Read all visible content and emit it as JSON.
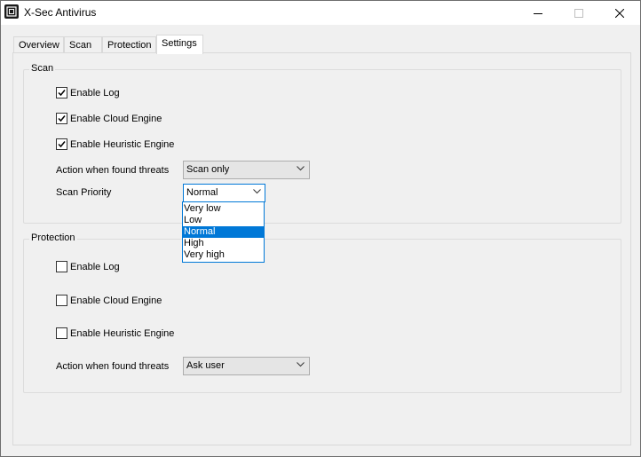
{
  "window": {
    "title": "X-Sec Antivirus"
  },
  "tabs": [
    {
      "label": "Overview",
      "active": false
    },
    {
      "label": "Scan",
      "active": false
    },
    {
      "label": "Protection",
      "active": false
    },
    {
      "label": "Settings",
      "active": true
    }
  ],
  "scan_group": {
    "title": "Scan",
    "enable_log": {
      "label": "Enable Log",
      "checked": true
    },
    "enable_cloud": {
      "label": "Enable Cloud Engine",
      "checked": true
    },
    "enable_heuristic": {
      "label": "Enable Heuristic Engine",
      "checked": true
    },
    "action_label": "Action when found threats",
    "action_value": "Scan only",
    "priority_label": "Scan Priority",
    "priority_value": "Normal",
    "priority_options": [
      "Very low",
      "Low",
      "Normal",
      "High",
      "Very high"
    ],
    "priority_selected_index": 2
  },
  "protection_group": {
    "title": "Protection",
    "enable_log": {
      "label": "Enable Log",
      "checked": false
    },
    "enable_cloud": {
      "label": "Enable Cloud Engine",
      "checked": false
    },
    "enable_heuristic": {
      "label": "Enable Heuristic Engine",
      "checked": false
    },
    "action_label": "Action when found threats",
    "action_value": "Ask user"
  },
  "colors": {
    "accent": "#0078d7",
    "window_bg": "#f0f0f0",
    "titlebar_bg": "#ffffff"
  },
  "icons": {
    "app": "app-logo-icon",
    "minimize": "minimize-icon",
    "maximize": "maximize-icon",
    "close": "close-icon",
    "chevron": "chevron-down-icon",
    "check": "checkmark-icon"
  }
}
